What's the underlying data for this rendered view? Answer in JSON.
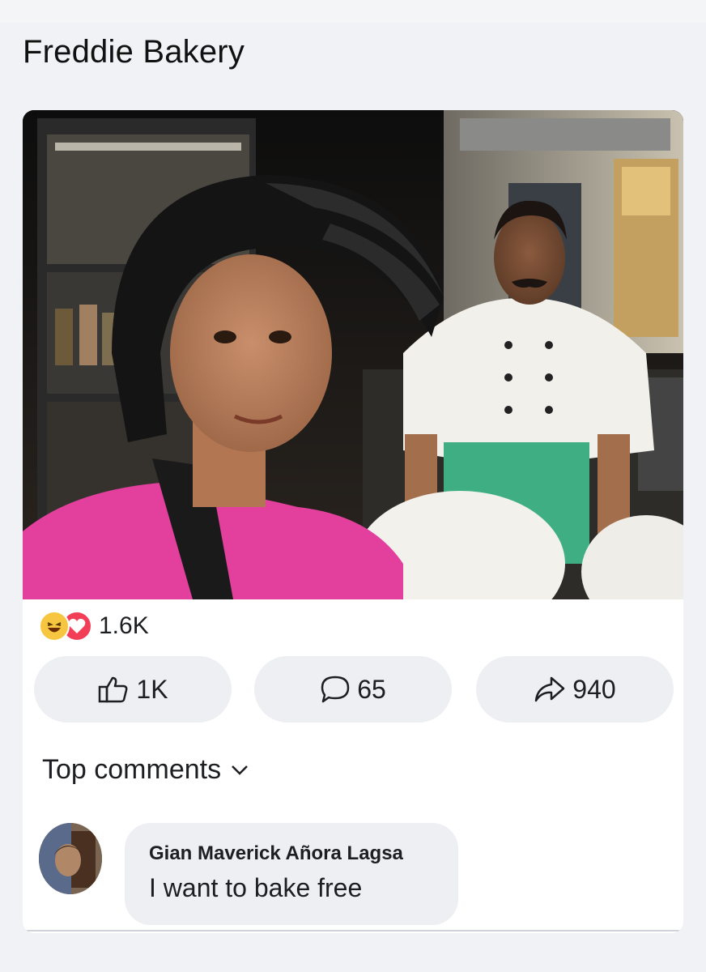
{
  "page": {
    "title": "Freddie Bakery"
  },
  "post": {
    "image_alt": "Selfie of a young man in a pink t-shirt and black helmet in front of a chef in white uniform and green apron at a night food stall",
    "reactions": {
      "icons": [
        "haha-reaction-icon",
        "love-reaction-icon"
      ],
      "count": "1.6K"
    },
    "actions": {
      "like_count": "1K",
      "comment_count": "65",
      "share_count": "940"
    }
  },
  "comments": {
    "sort_label": "Top comments",
    "items": [
      {
        "author": "Gian Maverick Añora Lagsa",
        "text": "I want to bake free"
      }
    ]
  },
  "colors": {
    "background": "#f1f2f5",
    "card": "#ffffff",
    "button_bg": "#eeeff3",
    "love": "#f33e58",
    "haha": "#f7c640",
    "shirt_pink": "#e3409e"
  }
}
